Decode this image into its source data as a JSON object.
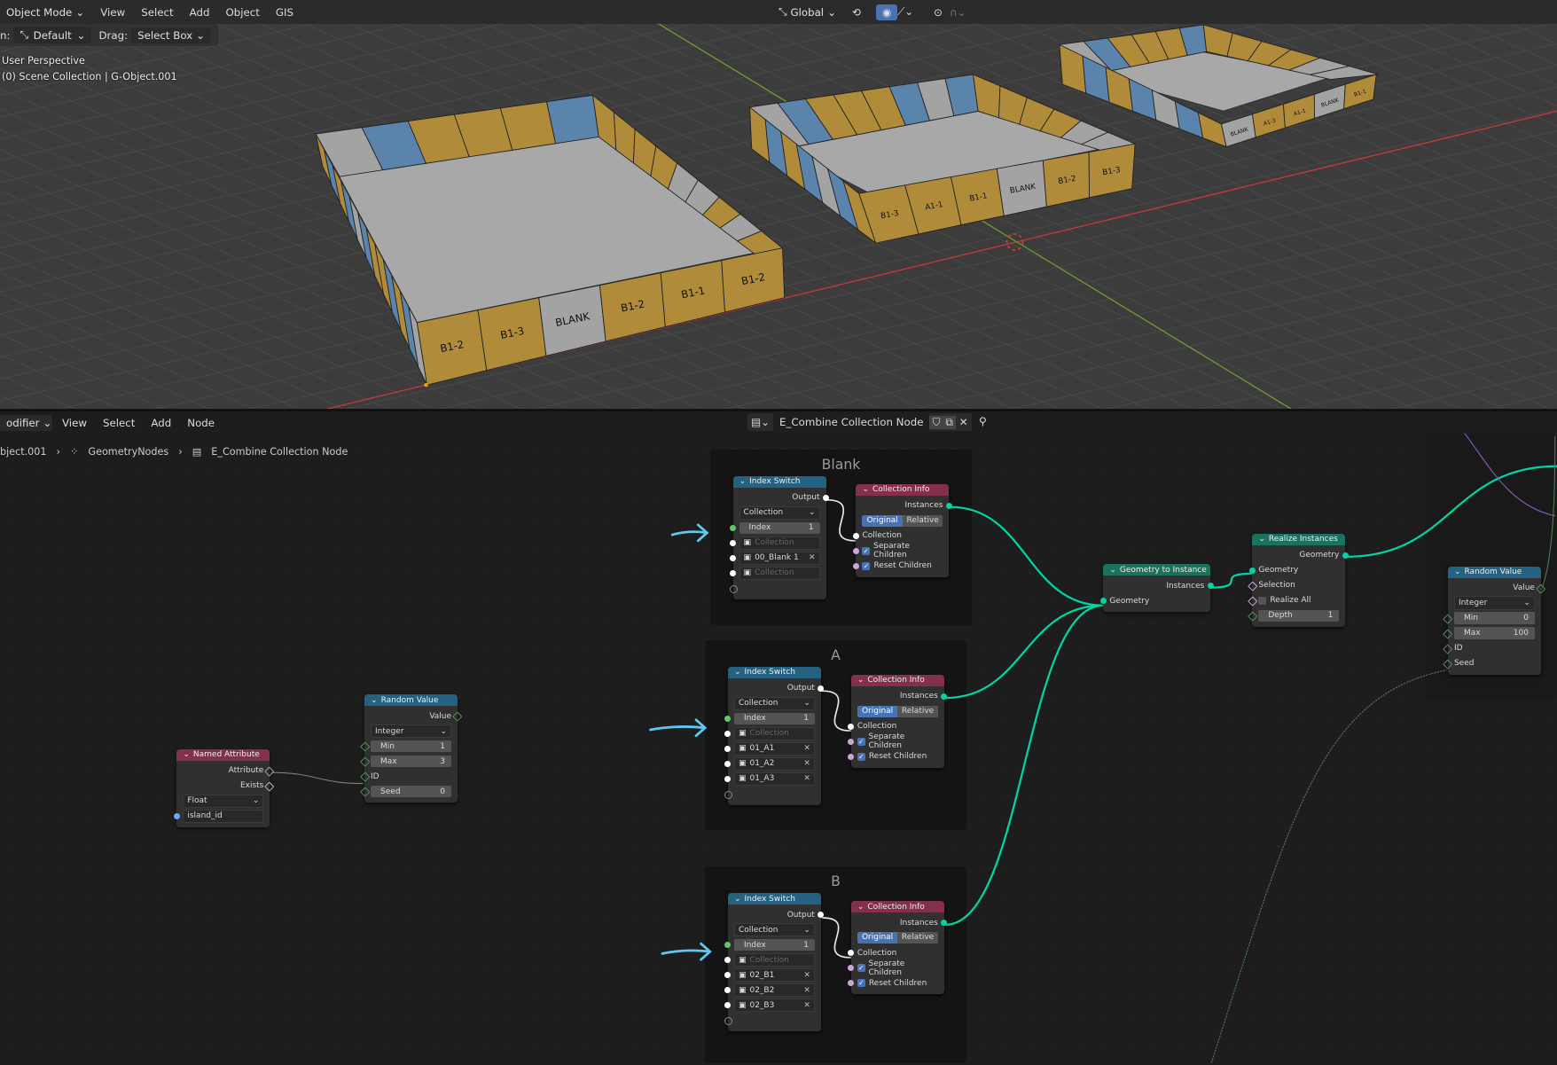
{
  "viewport": {
    "header": {
      "mode": "Object Mode",
      "menus": [
        "View",
        "Select",
        "Add",
        "Object",
        "GIS"
      ],
      "orientation": "Global"
    },
    "tool_settings": {
      "orientation_label_partial": "n:",
      "orientation_value": "Default",
      "drag_label": "Drag:",
      "drag_value": "Select Box"
    },
    "overlay": {
      "perspective": "User Perspective",
      "collection": "(0) Scene Collection | G-Object.001"
    },
    "trays": [
      {
        "front_labels": [
          "B1-2",
          "B1-3",
          "BLANK",
          "B1-2",
          "B1-1",
          "B1-2"
        ]
      },
      {
        "front_labels": [
          "B1-3",
          "A1-1",
          "B1-1",
          "BLANK",
          "B1-2",
          "B1-3"
        ]
      },
      {
        "front_labels": [
          "BLANK",
          "A1-3",
          "A1-1",
          "BLANK",
          "B1-1"
        ]
      }
    ],
    "colors": {
      "panel_gold": "#b08c3a",
      "panel_blue": "#5a84ab",
      "panel_gray": "#a3a3a3",
      "floor": "#a8a8a8",
      "x_axis": "#c0393d",
      "y_axis": "#6e9a2c"
    }
  },
  "node_editor": {
    "header": {
      "editor_type": "odifier",
      "menus": [
        "View",
        "Select",
        "Add",
        "Node"
      ],
      "node_tree": "E_Combine Collection Node"
    },
    "breadcrumb": [
      "bject.001",
      "GeometryNodes",
      "E_Combine Collection Node"
    ],
    "frames": {
      "blank": "Blank",
      "a": "A",
      "b": "B"
    },
    "colors": {
      "geometry_link": "#00d6a3",
      "header_utility": "#246283",
      "header_input": "#83314a",
      "header_geometry": "#1d725e",
      "arrow": "#5ec8f0"
    },
    "nodes": {
      "is_blank": {
        "title": "Index Switch",
        "type": "utility",
        "rows": [
          {
            "k": "out",
            "label": "Output",
            "sock": "#fff"
          },
          {
            "k": "sel",
            "value": "Collection"
          },
          {
            "k": "fld",
            "label": "Index",
            "value": "1",
            "sock": "#63c763"
          },
          {
            "k": "item",
            "value": "Collection",
            "placeholder": true,
            "sock": "#fff"
          },
          {
            "k": "item",
            "value": "00_Blank 1",
            "sock": "#fff"
          },
          {
            "k": "item",
            "value": "Collection",
            "placeholder": true,
            "sock": "#fff"
          },
          {
            "k": "empty"
          }
        ]
      },
      "ci_blank": {
        "title": "Collection Info",
        "type": "input",
        "rows": [
          {
            "k": "out",
            "label": "Instances",
            "sock": "#00d6a3"
          },
          {
            "k": "tog",
            "options": [
              "Original",
              "Relative"
            ],
            "active": 0
          },
          {
            "k": "in",
            "label": "Collection",
            "sock": "#fff"
          },
          {
            "k": "check",
            "label": "Separate Children",
            "checked": true,
            "sock": "#cca6d6"
          },
          {
            "k": "check",
            "label": "Reset Children",
            "checked": true,
            "sock": "#cca6d6"
          }
        ]
      },
      "is_a": {
        "title": "Index Switch",
        "type": "utility",
        "rows": [
          {
            "k": "out",
            "label": "Output",
            "sock": "#fff"
          },
          {
            "k": "sel",
            "value": "Collection"
          },
          {
            "k": "fld",
            "label": "Index",
            "value": "1",
            "sock": "#63c763"
          },
          {
            "k": "item",
            "value": "Collection",
            "placeholder": true,
            "sock": "#fff"
          },
          {
            "k": "item",
            "value": "01_A1",
            "sock": "#fff"
          },
          {
            "k": "item",
            "value": "01_A2",
            "sock": "#fff"
          },
          {
            "k": "item",
            "value": "01_A3",
            "sock": "#fff"
          },
          {
            "k": "empty"
          }
        ]
      },
      "ci_a": {
        "title": "Collection Info",
        "type": "input",
        "rows": [
          {
            "k": "out",
            "label": "Instances",
            "sock": "#00d6a3"
          },
          {
            "k": "tog",
            "options": [
              "Original",
              "Relative"
            ],
            "active": 0
          },
          {
            "k": "in",
            "label": "Collection",
            "sock": "#fff"
          },
          {
            "k": "check",
            "label": "Separate Children",
            "checked": true,
            "sock": "#cca6d6"
          },
          {
            "k": "check",
            "label": "Reset Children",
            "checked": true,
            "sock": "#cca6d6"
          }
        ]
      },
      "is_b": {
        "title": "Index Switch",
        "type": "utility",
        "rows": [
          {
            "k": "out",
            "label": "Output",
            "sock": "#fff"
          },
          {
            "k": "sel",
            "value": "Collection"
          },
          {
            "k": "fld",
            "label": "Index",
            "value": "1",
            "sock": "#63c763"
          },
          {
            "k": "item",
            "value": "Collection",
            "placeholder": true,
            "sock": "#fff"
          },
          {
            "k": "item",
            "value": "02_B1",
            "sock": "#fff"
          },
          {
            "k": "item",
            "value": "02_B2",
            "sock": "#fff"
          },
          {
            "k": "item",
            "value": "02_B3",
            "sock": "#fff"
          },
          {
            "k": "empty"
          }
        ]
      },
      "ci_b": {
        "title": "Collection Info",
        "type": "input",
        "rows": [
          {
            "k": "out",
            "label": "Instances",
            "sock": "#00d6a3"
          },
          {
            "k": "tog",
            "options": [
              "Original",
              "Relative"
            ],
            "active": 0
          },
          {
            "k": "in",
            "label": "Collection",
            "sock": "#fff"
          },
          {
            "k": "check",
            "label": "Separate Children",
            "checked": true,
            "sock": "#cca6d6"
          },
          {
            "k": "check",
            "label": "Reset Children",
            "checked": true,
            "sock": "#cca6d6"
          }
        ]
      },
      "gti": {
        "title": "Geometry to Instance",
        "type": "geometry",
        "rows": [
          {
            "k": "out",
            "label": "Instances",
            "sock": "#00d6a3"
          },
          {
            "k": "in",
            "label": "Geometry",
            "sock": "#00d6a3"
          }
        ]
      },
      "realize": {
        "title": "Realize Instances",
        "type": "geometry",
        "rows": [
          {
            "k": "out",
            "label": "Geometry",
            "sock": "#00d6a3"
          },
          {
            "k": "in",
            "label": "Geometry",
            "sock": "#00d6a3"
          },
          {
            "k": "in",
            "label": "Selection",
            "sock": "#cca6d6",
            "dia": true
          },
          {
            "k": "check",
            "label": "Realize All",
            "checked": false,
            "sock": "#cca6d6",
            "dia": true
          },
          {
            "k": "fld",
            "label": "Depth",
            "value": "1",
            "sock": "#598c5c",
            "dia": true
          }
        ]
      },
      "rv_right": {
        "title": "Random Value",
        "type": "utility",
        "rows": [
          {
            "k": "out",
            "label": "Value",
            "sock": "#598c5c",
            "dia": true
          },
          {
            "k": "sel",
            "value": "Integer"
          },
          {
            "k": "fld",
            "label": "Min",
            "value": "0",
            "sock": "#598c5c",
            "dia": true
          },
          {
            "k": "fld",
            "label": "Max",
            "value": "100",
            "sock": "#598c5c",
            "dia": true
          },
          {
            "k": "in",
            "label": "ID",
            "sock": "#598c5c",
            "dia": true
          },
          {
            "k": "in",
            "label": "Seed",
            "sock": "#598c5c",
            "dia": true
          }
        ]
      },
      "rv_left": {
        "title": "Random Value",
        "type": "utility",
        "rows": [
          {
            "k": "out",
            "label": "Value",
            "sock": "#598c5c",
            "dia": true
          },
          {
            "k": "sel",
            "value": "Integer"
          },
          {
            "k": "fld",
            "label": "Min",
            "value": "1",
            "sock": "#598c5c",
            "dia": true
          },
          {
            "k": "fld",
            "label": "Max",
            "value": "3",
            "sock": "#598c5c",
            "dia": true
          },
          {
            "k": "in",
            "label": "ID",
            "sock": "#598c5c",
            "dia": true
          },
          {
            "k": "fld",
            "label": "Seed",
            "value": "0",
            "sock": "#598c5c",
            "dia": true
          }
        ]
      },
      "named_attr": {
        "title": "Named Attribute",
        "type": "input",
        "rows": [
          {
            "k": "out",
            "label": "Attribute",
            "sock": "#a1a1a1",
            "dia": true
          },
          {
            "k": "out",
            "label": "Exists",
            "sock": "#cca6d6",
            "dia": true
          },
          {
            "k": "sel",
            "value": "Float"
          },
          {
            "k": "txt",
            "value": "island_id",
            "sock": "#6ba6ff"
          }
        ]
      }
    }
  }
}
